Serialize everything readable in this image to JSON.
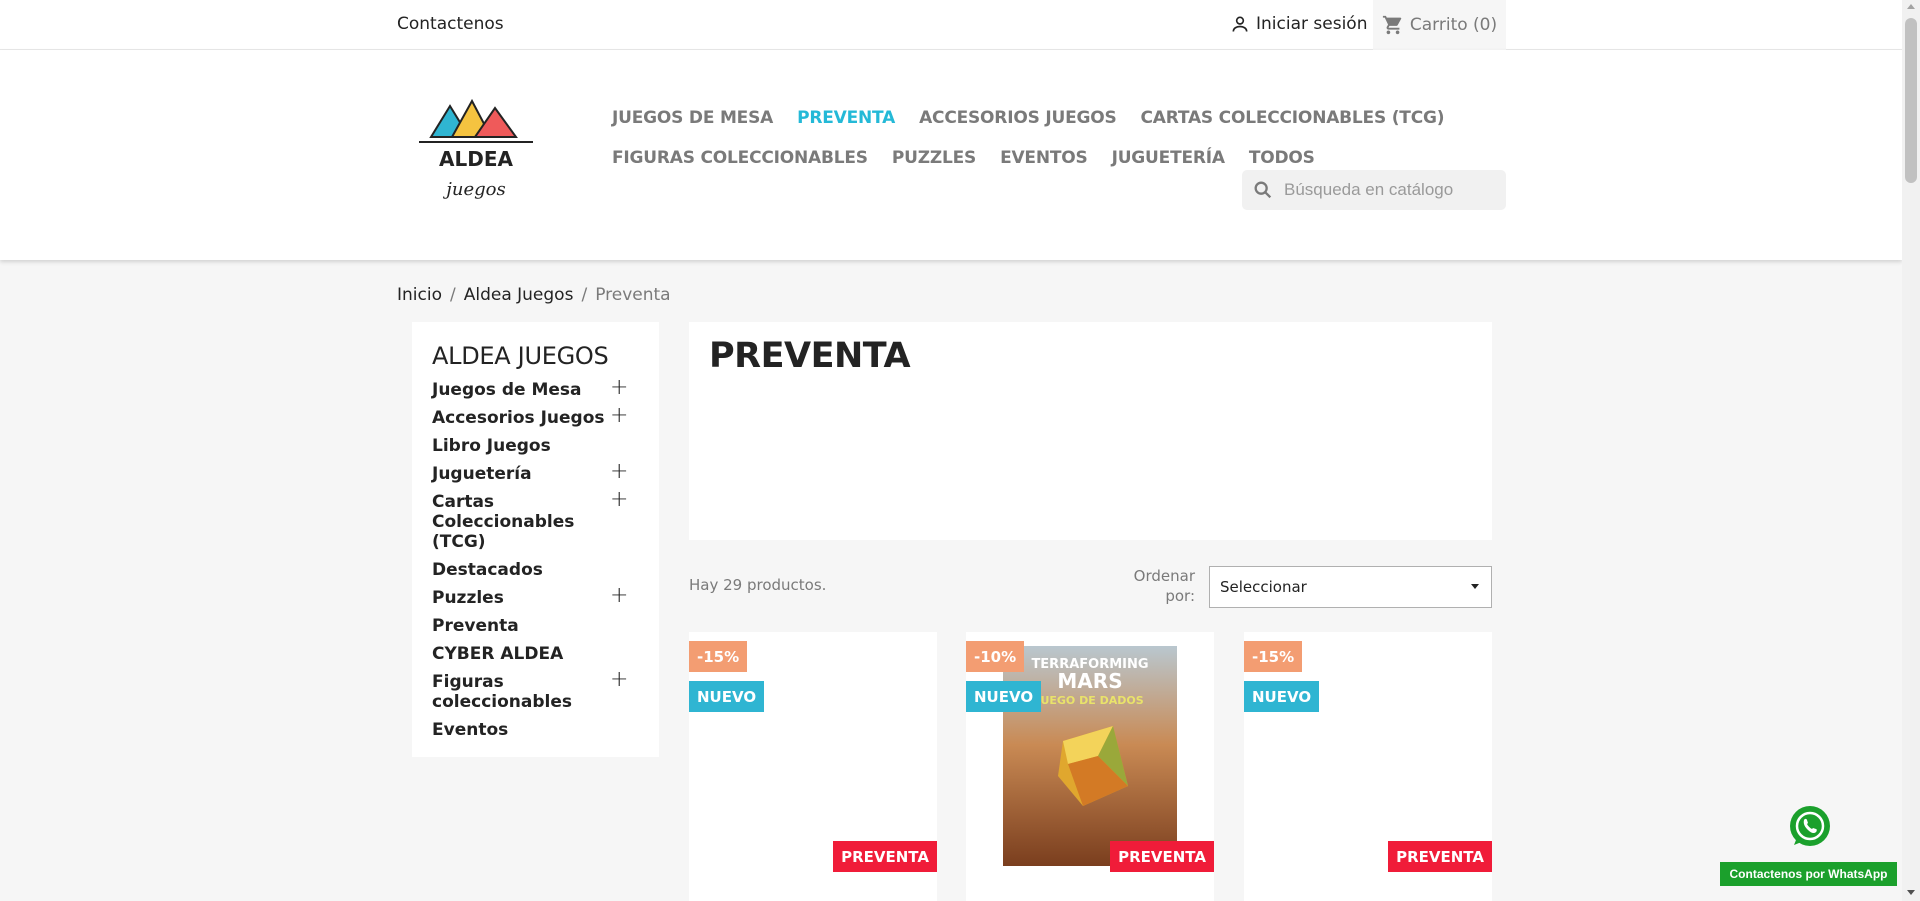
{
  "topbar": {
    "contact": "Contactenos",
    "signin": "Iniciar sesión",
    "cart": "Carrito (0)"
  },
  "logo": {
    "line1": "ALDEA",
    "line2": "juegos"
  },
  "nav": {
    "row1": [
      "JUEGOS DE MESA",
      "PREVENTA",
      "ACCESORIOS JUEGOS",
      "CARTAS COLECCIONABLES (TCG)"
    ],
    "row2": [
      "FIGURAS COLECCIONABLES",
      "PUZZLES",
      "EVENTOS",
      "JUGUETERÍA",
      "TODOS"
    ],
    "active": "PREVENTA"
  },
  "search": {
    "placeholder": "Búsqueda en catálogo"
  },
  "breadcrumb": {
    "items": [
      "Inicio",
      "Aldea Juegos"
    ],
    "current": "Preventa",
    "separator": "/"
  },
  "sidebar": {
    "title": "ALDEA JUEGOS",
    "categories": [
      {
        "label": "Juegos de Mesa",
        "expandable": true
      },
      {
        "label": "Accesorios Juegos",
        "expandable": true
      },
      {
        "label": "Libro Juegos",
        "expandable": false
      },
      {
        "label": "Juguetería",
        "expandable": true
      },
      {
        "label": "Cartas Coleccionables (TCG)",
        "expandable": true
      },
      {
        "label": "Destacados",
        "expandable": false
      },
      {
        "label": "Puzzles",
        "expandable": true
      },
      {
        "label": "Preventa",
        "expandable": false
      },
      {
        "label": "CYBER ALDEA",
        "expandable": false
      },
      {
        "label": "Figuras coleccionables",
        "expandable": true
      },
      {
        "label": "Eventos",
        "expandable": false
      }
    ]
  },
  "main": {
    "title": "PREVENTA",
    "count": "Hay 29 productos.",
    "sort_label": "Ordenar por:",
    "sort_value": "Seleccionar"
  },
  "products": [
    {
      "discount": "-15%",
      "new": "NUEVO",
      "flag": "PREVENTA",
      "has_image": false
    },
    {
      "discount": "-10%",
      "new": "NUEVO",
      "flag": "PREVENTA",
      "has_image": true,
      "image_title_1": "TERRAFORMING",
      "image_title_2": "MARS",
      "image_subtitle": "JUEGO DE DADOS"
    },
    {
      "discount": "-15%",
      "new": "NUEVO",
      "flag": "PREVENTA",
      "has_image": false
    }
  ],
  "whatsapp": {
    "label": "Contactenos por WhatsApp"
  },
  "colors": {
    "accent": "#24b9d7",
    "discount": "#f39d72",
    "new": "#2fb5d2",
    "preorder": "#f01c39",
    "whatsapp": "#1ba02c"
  }
}
